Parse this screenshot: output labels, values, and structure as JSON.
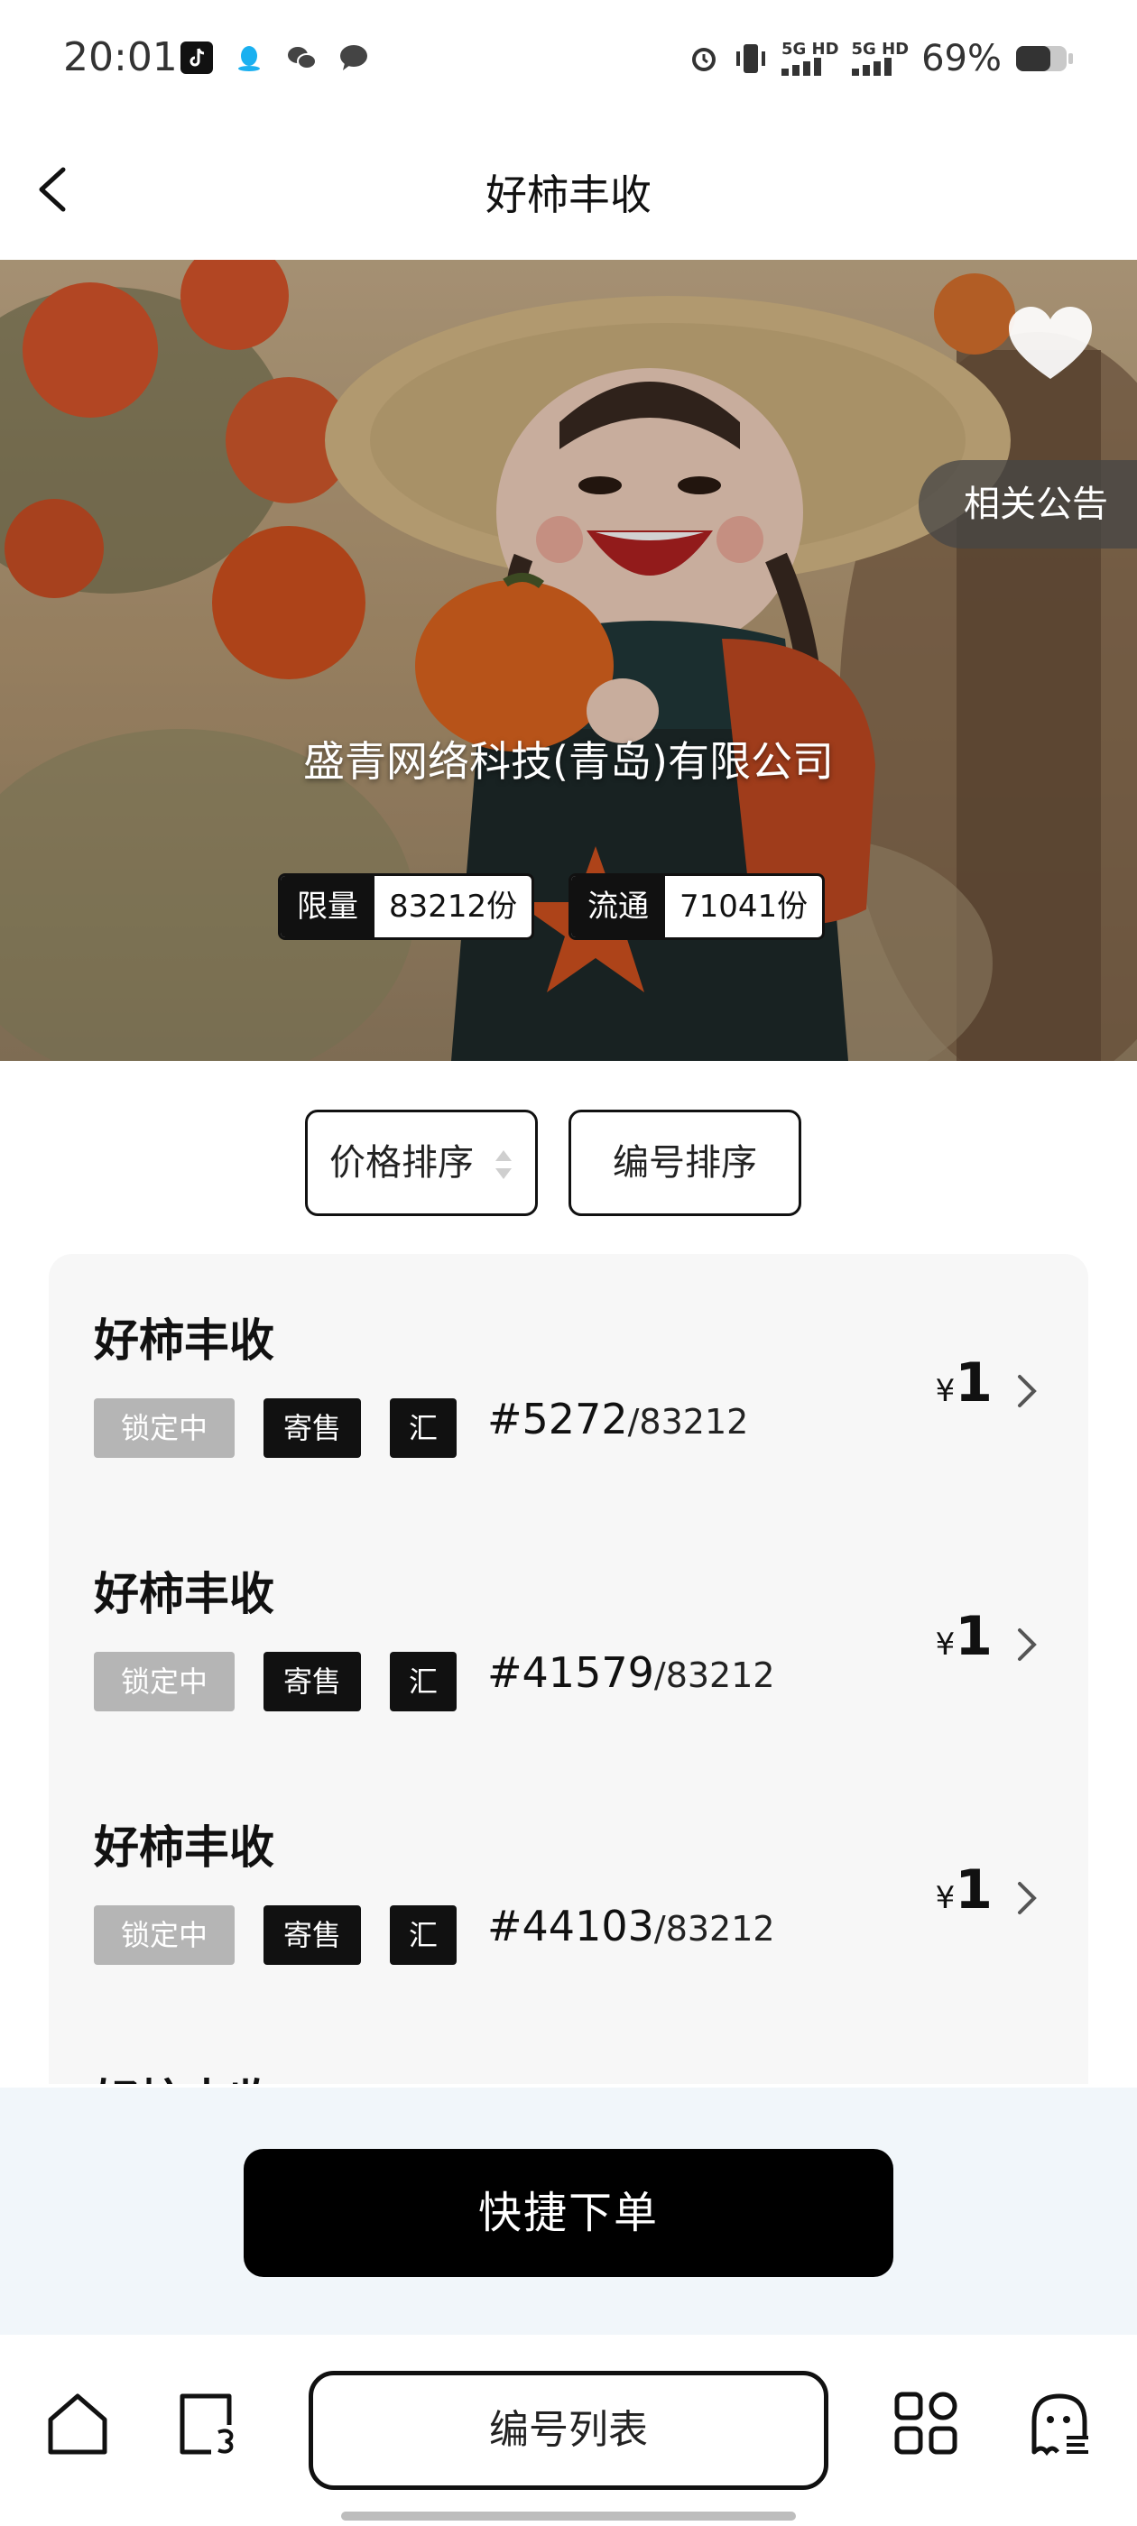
{
  "status_bar": {
    "time": "20:01",
    "app_icons": [
      "douyin-icon",
      "qq-icon",
      "wechat-icon",
      "message-icon"
    ],
    "network_1": "5G HD",
    "network_2": "5G HD",
    "battery": "69%"
  },
  "nav": {
    "title": "好柿丰收",
    "back_icon": "chevron-left-icon"
  },
  "hero": {
    "notice_label": "相关公告",
    "issuer": "盛青网络科技(青岛)有限公司",
    "limit_label": "限量",
    "limit_value": "83212份",
    "circulation_label": "流通",
    "circulation_value": "71041份",
    "favorite_icon": "heart-icon"
  },
  "sort": {
    "price_label": "价格排序",
    "number_label": "编号排序"
  },
  "items": [
    {
      "title": "好柿丰收",
      "status": "锁定中",
      "type": "寄售",
      "tag": "汇",
      "number": "#5272",
      "total": "/83212",
      "currency": "¥",
      "price": "1"
    },
    {
      "title": "好柿丰收",
      "status": "锁定中",
      "type": "寄售",
      "tag": "汇",
      "number": "#41579",
      "total": "/83212",
      "currency": "¥",
      "price": "1"
    },
    {
      "title": "好柿丰收",
      "status": "锁定中",
      "type": "寄售",
      "tag": "汇",
      "number": "#44103",
      "total": "/83212",
      "currency": "¥",
      "price": "1"
    },
    {
      "title": "好柿丰收"
    }
  ],
  "quick_order": {
    "label": "快捷下单"
  },
  "bottom_nav": {
    "home_icon": "home-icon",
    "copy_icon": "stack-icon",
    "list_label": "编号列表",
    "apps_icon": "apps-grid-icon",
    "profile_icon": "ghost-profile-icon"
  },
  "colors": {
    "primary": "#000000",
    "locked_tag": "#b5b5b5",
    "list_bg": "#f7f7f7",
    "quick_bg": "#f1f6fa"
  }
}
